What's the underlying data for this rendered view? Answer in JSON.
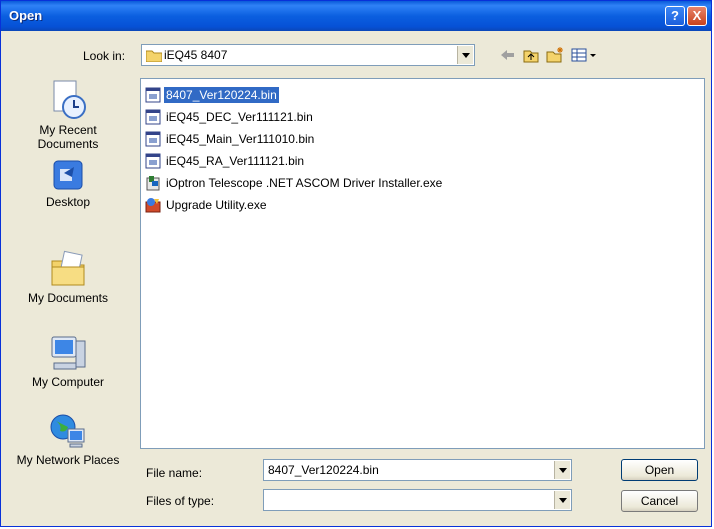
{
  "window": {
    "title": "Open"
  },
  "title_buttons": {
    "help": "?",
    "close": "X"
  },
  "look_in": {
    "label": "Look in:",
    "value": "iEQ45 8407"
  },
  "toolbar": {
    "back_icon": "back-arrow-icon",
    "up_icon": "up-folder-icon",
    "new_folder_icon": "new-folder-icon",
    "views_icon": "views-menu-icon"
  },
  "places": [
    {
      "label": "My Recent Documents",
      "icon": "recent-documents-icon"
    },
    {
      "label": "Desktop",
      "icon": "desktop-icon"
    },
    {
      "label": "My Documents",
      "icon": "my-documents-icon"
    },
    {
      "label": "My Computer",
      "icon": "my-computer-icon"
    },
    {
      "label": "My Network Places",
      "icon": "network-places-icon"
    }
  ],
  "files": [
    {
      "name": "8407_Ver120224.bin",
      "type": "bin",
      "selected": true
    },
    {
      "name": "iEQ45_DEC_Ver111121.bin",
      "type": "bin",
      "selected": false
    },
    {
      "name": "iEQ45_Main_Ver111010.bin",
      "type": "bin",
      "selected": false
    },
    {
      "name": "iEQ45_RA_Ver111121.bin",
      "type": "bin",
      "selected": false
    },
    {
      "name": "iOptron Telescope .NET ASCOM Driver Installer.exe",
      "type": "installer",
      "selected": false
    },
    {
      "name": "Upgrade Utility.exe",
      "type": "exe",
      "selected": false
    }
  ],
  "file_name": {
    "label": "File name:",
    "value": "8407_Ver120224.bin"
  },
  "file_type": {
    "label": "Files of type:",
    "value": ""
  },
  "buttons": {
    "open": "Open",
    "cancel": "Cancel"
  }
}
